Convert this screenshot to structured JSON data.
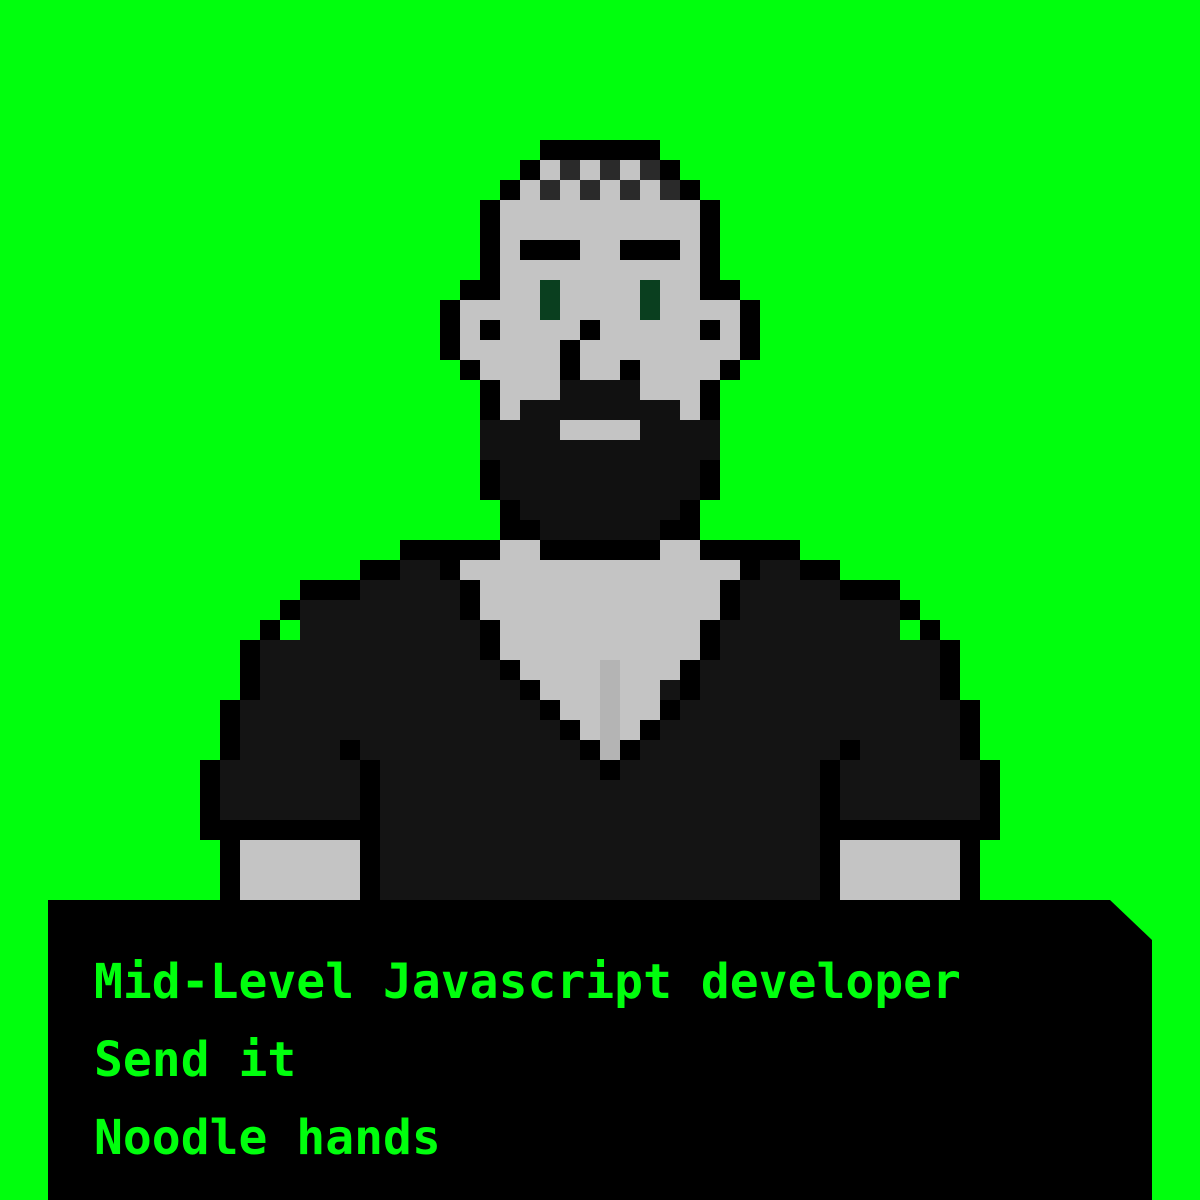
{
  "colors": {
    "background": "#00FF0D",
    "text": "#00FF0D",
    "panel": "#000000",
    "outline": "#000000",
    "skin": "#C4C4C4",
    "beard": "#111111",
    "hair": "#2A2A2A",
    "eyes": "#0A3F1F",
    "shirt": "#141414",
    "chain": "#B4B4B4"
  },
  "traits": [
    "Mid-Level Javascript developer",
    "Send it",
    "Noodle hands"
  ]
}
